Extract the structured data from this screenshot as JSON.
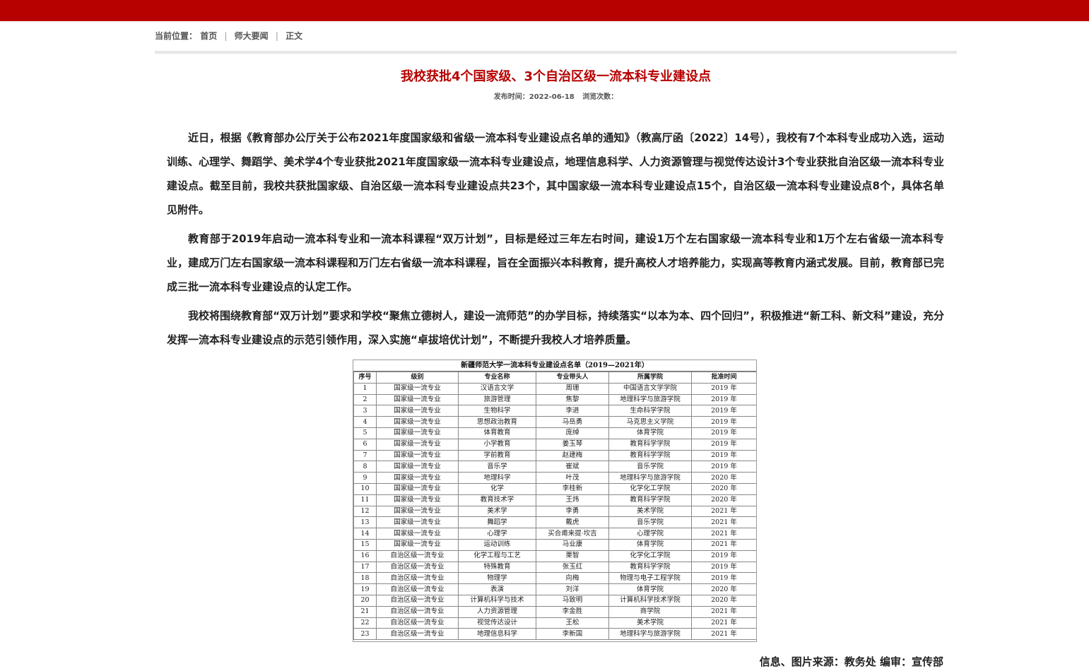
{
  "breadcrumb": {
    "label": "当前位置：",
    "items": [
      "首页",
      "师大要闻",
      "正文"
    ]
  },
  "article": {
    "title": "我校获批4个国家级、3个自治区级一流本科专业建设点",
    "meta": {
      "publish": "发布时间：2022-06-18",
      "views": "浏览次数："
    },
    "paragraphs": [
      "近日，根据《教育部办公厅关于公布2021年度国家级和省级一流本科专业建设点名单的通知》（教高厅函〔2022〕14号），我校有7个本科专业成功入选，运动训练、心理学、舞蹈学、美术学4个专业获批2021年度国家级一流本科专业建设点，地理信息科学、人力资源管理与视觉传达设计3个专业获批自治区级一流本科专业建设点。截至目前，我校共获批国家级、自治区级一流本科专业建设点共23个，其中国家级一流本科专业建设点15个，自治区级一流本科专业建设点8个，具体名单见附件。",
      "教育部于2019年启动一流本科专业和一流本科课程“双万计划”，目标是经过三年左右时间，建设1万个左右国家级一流本科专业和1万个左右省级一流本科专业，建成万门左右国家级一流本科课程和万门左右省级一流本科课程，旨在全面振兴本科教育，提升高校人才培养能力，实现高等教育内涵式发展。目前，教育部已完成三批一流本科专业建设点的认定工作。",
      "我校将围绕教育部“双万计划”要求和学校“聚焦立德树人，建设一流师范”的办学目标，持续落实“以本为本、四个回归”，积极推进“新工科、新文科”建设，充分发挥一流本科专业建设点的示范引领作用，深入实施“卓拔培优计划”，不断提升我校人才培养质量。"
    ],
    "footer": "信息、图片来源：教务处  编审：宣传部"
  },
  "table": {
    "title": "新疆师范大学一流本科专业建设点名单（2019—2021年）",
    "headers": [
      "序号",
      "级别",
      "专业名称",
      "专业带头人",
      "所属学院",
      "批准时间"
    ],
    "rows": [
      [
        "1",
        "国家级一流专业",
        "汉语言文学",
        "周珊",
        "中国语言文学学院",
        "2019 年"
      ],
      [
        "2",
        "国家级一流专业",
        "旅游管理",
        "焦黎",
        "地理科学与旅游学院",
        "2019 年"
      ],
      [
        "3",
        "国家级一流专业",
        "生物科学",
        "李进",
        "生命科学学院",
        "2019 年"
      ],
      [
        "4",
        "国家级一流专业",
        "思想政治教育",
        "马岳勇",
        "马克思主义学院",
        "2019 年"
      ],
      [
        "5",
        "国家级一流专业",
        "体育教育",
        "庞绰",
        "体育学院",
        "2019 年"
      ],
      [
        "6",
        "国家级一流专业",
        "小学教育",
        "姜玉琴",
        "教育科学学院",
        "2019 年"
      ],
      [
        "7",
        "国家级一流专业",
        "学前教育",
        "赵建梅",
        "教育科学学院",
        "2019 年"
      ],
      [
        "8",
        "国家级一流专业",
        "音乐学",
        "崔斌",
        "音乐学院",
        "2019 年"
      ],
      [
        "9",
        "国家级一流专业",
        "地理科学",
        "叶茂",
        "地理科学与旅游学院",
        "2020 年"
      ],
      [
        "10",
        "国家级一流专业",
        "化学",
        "李桂新",
        "化学化工学院",
        "2020 年"
      ],
      [
        "11",
        "国家级一流专业",
        "教育技术学",
        "王炜",
        "教育科学学院",
        "2020 年"
      ],
      [
        "12",
        "国家级一流专业",
        "美术学",
        "李勇",
        "美术学院",
        "2021 年"
      ],
      [
        "13",
        "国家级一流专业",
        "舞蹈学",
        "戴虎",
        "音乐学院",
        "2021 年"
      ],
      [
        "14",
        "国家级一流专业",
        "心理学",
        "买合甫来提·坎吉",
        "心理学院",
        "2021 年"
      ],
      [
        "15",
        "国家级一流专业",
        "运动训练",
        "马业康",
        "体育学院",
        "2021 年"
      ],
      [
        "16",
        "自治区级一流专业",
        "化学工程与工艺",
        "栗智",
        "化学化工学院",
        "2019 年"
      ],
      [
        "17",
        "自治区级一流专业",
        "特殊教育",
        "张玉红",
        "教育科学学院",
        "2019 年"
      ],
      [
        "18",
        "自治区级一流专业",
        "物理学",
        "向梅",
        "物理与电子工程学院",
        "2019 年"
      ],
      [
        "19",
        "自治区级一流专业",
        "表演",
        "刘洋",
        "体育学院",
        "2020 年"
      ],
      [
        "20",
        "自治区级一流专业",
        "计算机科学与技术",
        "马致明",
        "计算机科学技术学院",
        "2020 年"
      ],
      [
        "21",
        "自治区级一流专业",
        "人力资源管理",
        "李金胜",
        "商学院",
        "2021 年"
      ],
      [
        "22",
        "自治区级一流专业",
        "视觉传达设计",
        "王松",
        "美术学院",
        "2021 年"
      ],
      [
        "23",
        "自治区级一流专业",
        "地理信息科学",
        "李新国",
        "地理科学与旅游学院",
        "2021 年"
      ]
    ]
  },
  "colors": {
    "brand": "#b70000",
    "divider": "#e6e6e6"
  }
}
